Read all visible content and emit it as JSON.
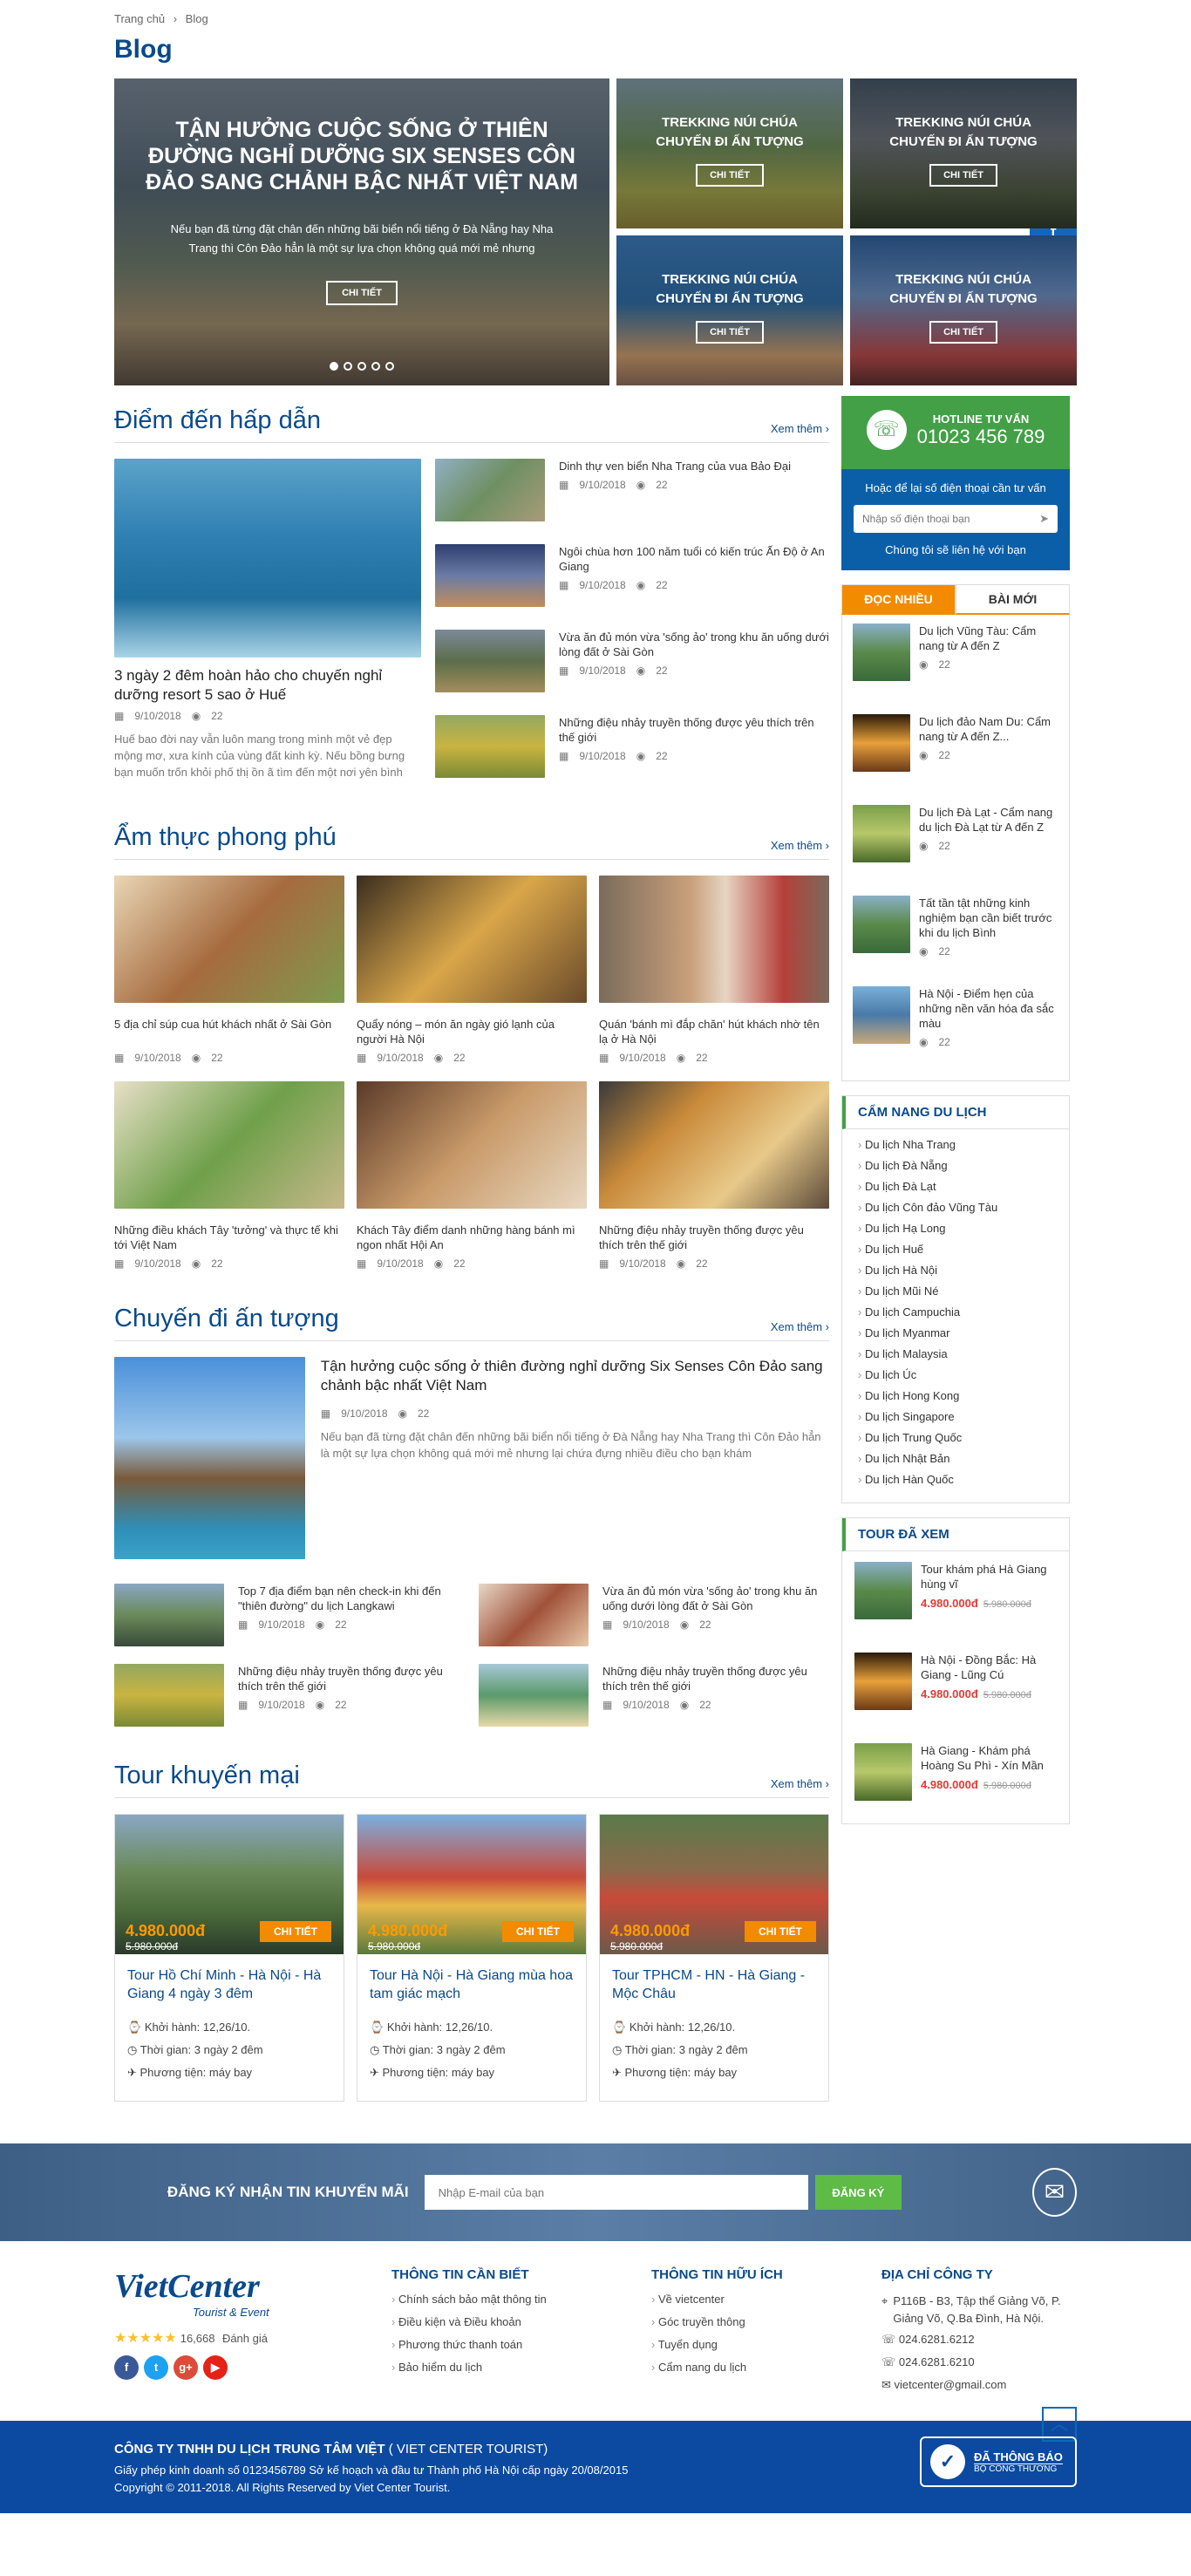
{
  "breadcrumb": {
    "home": "Trang chủ",
    "sep": "›",
    "current": "Blog"
  },
  "page_title": "Blog",
  "hero": {
    "main": {
      "title": "TẬN HƯỞNG CUỘC SỐNG Ở THIÊN ĐƯỜNG NGHỈ DƯỠNG SIX SENSES CÔN ĐẢO SANG CHẢNH BẬC NHẤT VIỆT NAM",
      "desc": "Nếu bạn đã từng đặt chân đến những bãi biển nổi tiếng ở Đà Nẵng hay Nha Trang thì Côn Đảo hẳn là một sự lựa chọn không quá mới mẻ nhưng",
      "button": "CHI TIẾT"
    },
    "tiles": [
      {
        "title": "TREKKING NÚI CHÚA CHUYẾN ĐI ẤN TƯỢNG",
        "button": "CHI TIẾT"
      },
      {
        "title": "TREKKING NÚI CHÚA CHUYẾN ĐI ẤN TƯỢNG",
        "button": "CHI TIẾT"
      },
      {
        "title": "TREKKING NÚI CHÚA CHUYẾN ĐI ẤN TƯỢNG",
        "button": "CHI TIẾT"
      },
      {
        "title": "TREKKING NÚI CHÚA CHUYẾN ĐI ẤN TƯỢNG",
        "button": "CHI TIẾT"
      }
    ]
  },
  "view_more": "Xem thêm ›",
  "destinations": {
    "title": "Điểm đến hấp dẫn",
    "main": {
      "title": "3 ngày 2 đêm hoàn hảo cho chuyến nghỉ dưỡng resort 5 sao ở Huế",
      "date": "9/10/2018",
      "views": "22",
      "desc": "Huế bao đời nay vẫn luôn mang trong mình một vẻ đẹp mộng mơ, xưa kính của vùng đất kinh kỳ. Nếu bồng bưng bạn muốn trốn khỏi phố thị ồn ã tìm đến một nơi yên bình"
    },
    "items": [
      {
        "title": "Dinh thự ven biển Nha Trang của vua Bảo Đại",
        "date": "9/10/2018",
        "views": "22"
      },
      {
        "title": "Ngôi chùa hơn 100 năm tuổi có kiến trúc Ấn Độ ở An Giang",
        "date": "9/10/2018",
        "views": "22"
      },
      {
        "title": "Vừa ăn đủ món vừa 'sống ảo' trong khu ăn uống dưới lòng đất ở Sài Gòn",
        "date": "9/10/2018",
        "views": "22"
      },
      {
        "title": "Những điệu nhảy truyền thống được yêu thích trên thế giới",
        "date": "9/10/2018",
        "views": "22"
      }
    ]
  },
  "food": {
    "title": "Ẩm thực phong phú",
    "items": [
      {
        "title": "5 địa chỉ súp cua hút khách nhất ở Sài Gòn",
        "date": "9/10/2018",
        "views": "22"
      },
      {
        "title": "Quẩy nóng – món ăn ngày gió lạnh của người Hà Nội",
        "date": "9/10/2018",
        "views": "22"
      },
      {
        "title": "Quán 'bánh mì đắp chăn' hút khách nhờ tên lạ ở Hà Nội",
        "date": "9/10/2018",
        "views": "22"
      },
      {
        "title": "Những điều khách Tây 'tưởng' và thực tế khi tới Việt Nam",
        "date": "9/10/2018",
        "views": "22"
      },
      {
        "title": "Khách Tây điểm danh những hàng bánh mì ngon nhất Hội An",
        "date": "9/10/2018",
        "views": "22"
      },
      {
        "title": "Những điệu nhảy truyền thống được yêu thích trên thế giới",
        "date": "9/10/2018",
        "views": "22"
      }
    ]
  },
  "trips": {
    "title": "Chuyến đi ấn tượng",
    "main": {
      "title": "Tận hưởng cuộc sống ở thiên đường nghỉ dưỡng Six Senses Côn Đảo sang chảnh bậc nhất Việt Nam",
      "date": "9/10/2018",
      "views": "22",
      "desc": "Nếu bạn đã từng đặt chân đến những bãi biển nổi tiếng ở Đà Nẵng hay Nha Trang thì Côn Đảo hẳn là một sự lựa chọn không quá mới mẻ nhưng lại chứa đựng nhiều điều cho bạn khám"
    },
    "items": [
      {
        "title": "Top 7 địa điểm bạn nên check-in khi đến \"thiên đường\" du lịch Langkawi",
        "date": "9/10/2018",
        "views": "22"
      },
      {
        "title": "Vừa ăn đủ món vừa 'sống ảo' trong khu ăn uống dưới lòng đất ở Sài Gòn",
        "date": "9/10/2018",
        "views": "22"
      },
      {
        "title": "Những điệu nhảy truyền thống được yêu thích trên thế giới",
        "date": "9/10/2018",
        "views": "22"
      },
      {
        "title": "Những điệu nhảy truyền thống được yêu thích trên thế giới",
        "date": "9/10/2018",
        "views": "22"
      }
    ]
  },
  "tours": {
    "title": "Tour khuyến mại",
    "button": "CHI TIẾT",
    "depart_label": "Khởi hành:",
    "time_label": "Thời gian:",
    "vehicle_label": "Phương tiện:",
    "items": [
      {
        "title": "Tour Hồ Chí Minh - Hà Nội - Hà Giang 4 ngày 3 đêm",
        "price": "4.980.000đ",
        "old": "5.980.000đ",
        "depart": "12,26/10.",
        "time": "3 ngày 2 đêm",
        "vehicle": "máy bay"
      },
      {
        "title": "Tour Hà Nội - Hà Giang mùa hoa tam giác mạch",
        "price": "4.980.000đ",
        "old": "5.980.000đ",
        "depart": "12,26/10.",
        "time": "3 ngày 2 đêm",
        "vehicle": "máy bay"
      },
      {
        "title": "Tour TPHCM - HN - Hà Giang - Mộc Châu",
        "price": "4.980.000đ",
        "old": "5.980.000đ",
        "depart": "12,26/10.",
        "time": "3 ngày 2 đêm",
        "vehicle": "máy bay"
      }
    ]
  },
  "sidebar": {
    "hotline_label": "HOTLINE TƯ VẤN",
    "hotline_number": "01023 456 789",
    "form_text": "Hoặc để lại số điện thoại cần tư vấn",
    "phone_placeholder": "Nhập số điện thoại bạn",
    "form_note": "Chúng tôi sẽ liên hệ với bạn",
    "tab_popular": "ĐỌC NHIỀU",
    "tab_new": "BÀI MỚI",
    "popular": [
      {
        "title": "Du lịch Vũng Tàu: Cẩm nang từ A đến Z",
        "views": "22"
      },
      {
        "title": "Du lịch đảo Nam Du: Cẩm nang từ A đến Z...",
        "views": "22"
      },
      {
        "title": "Du lịch Đà Lạt - Cẩm nang du lịch Đà Lạt từ A đến Z",
        "views": "22"
      },
      {
        "title": "Tất tần tật những kinh nghiệm bạn cần biết trước khi du lịch Bình",
        "views": "22"
      },
      {
        "title": "Hà Nội - Điểm hẹn của những nền văn hóa đa sắc màu",
        "views": "22"
      }
    ],
    "handbook_title": "CẨM NANG DU LỊCH",
    "handbook": [
      "Du lịch Nha Trang",
      "Du lịch Đà Nẵng",
      "Du lịch Đà Lạt",
      "Du lịch Côn đảo Vũng Tàu",
      "Du lịch Hạ Long",
      "Du lịch Huế",
      "Du lịch Hà Nội",
      "Du lịch Mũi Né",
      "Du lịch Campuchia",
      "Du lịch Myanmar",
      "Du lịch Malaysia",
      "Du lịch Úc",
      "Du lịch Hong Kong",
      "Du lịch Singapore",
      "Du lịch Trung Quốc",
      "Du lịch Nhật Bản",
      "Du lịch Hàn Quốc"
    ],
    "viewed_title": "TOUR ĐÃ XEM",
    "viewed": [
      {
        "title": "Tour khám phá Hà Giang hùng vĩ",
        "price": "4.980.000đ",
        "old": "5.980.000đ"
      },
      {
        "title": "Hà Nội - Đồng Bắc: Hà Giang - Lũng Cú",
        "price": "4.980.000đ",
        "old": "5.980.000đ"
      },
      {
        "title": "Hà Giang - Khám phá Hoàng Su Phì - Xín Mần",
        "price": "4.980.000đ",
        "old": "5.980.000đ"
      }
    ]
  },
  "newsletter": {
    "title": "ĐĂNG KÝ NHẬN TIN KHUYẾN MÃI",
    "placeholder": "Nhập E-mail của bạn",
    "button": "ĐĂNG KÝ"
  },
  "footer": {
    "logo": "VietCenter",
    "logo_sub": "Tourist & Event",
    "rating": "16,668",
    "rating_label": "Đánh giá",
    "col1_title": "THÔNG TIN CẦN BIẾT",
    "col1": [
      "Chính sách bảo mật thông tin",
      "Điều kiện và Điều khoản",
      "Phương thức thanh toán",
      "Bảo hiểm du lịch"
    ],
    "col2_title": "THÔNG TIN HỮU ÍCH",
    "col2": [
      "Về vietcenter",
      "Góc truyền thông",
      "Tuyển dụng",
      "Cẩm nang du lịch"
    ],
    "col3_title": "ĐỊA CHỈ CÔNG TY",
    "address": "P116B - B3, Tập thể Giảng Võ, P. Giảng Võ, Q.Ba Đình, Hà Nội.",
    "phone1": "024.6281.6212",
    "phone2": "024.6281.6210",
    "email": "vietcenter@gmail.com",
    "company": "CÔNG TY TNHH DU LỊCH TRUNG TÂM VIỆT",
    "company_en": "( VIET CENTER TOURIST)",
    "license": "Giấy phép kinh doanh số 0123456789  Sở kế hoạch và đầu tư Thành phố Hà Nội cấp ngày 20/08/2015",
    "copyright": "Copyright © 2011-2018. All Rights Reserved by Viet Center Tourist.",
    "badge_top": "ĐÃ THÔNG BÁO",
    "badge_bottom": "BỘ CÔNG THƯƠNG"
  }
}
